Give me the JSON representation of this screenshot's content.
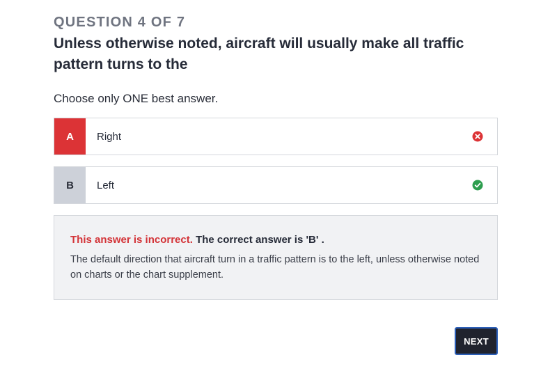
{
  "question": {
    "counter": "QUESTION 4 OF 7",
    "text": "Unless otherwise noted, aircraft will usually make all traffic pattern turns to the",
    "instruction": "Choose only ONE best answer."
  },
  "options": [
    {
      "letter": "A",
      "label": "Right",
      "state": "incorrect-selected",
      "status_icon": "x-circle-icon",
      "accent_color": "#dc3336"
    },
    {
      "letter": "B",
      "label": "Left",
      "state": "correct",
      "status_icon": "check-circle-icon",
      "accent_color": "#2e9e4f"
    }
  ],
  "feedback": {
    "incorrect_label": "This answer is incorrect.",
    "correct_answer": "The correct answer is 'B' .",
    "explanation": "The default direction that aircraft turn in a traffic pattern is to the left, unless otherwise noted on charts or the chart supplement."
  },
  "next_button": {
    "label": "NEXT"
  }
}
